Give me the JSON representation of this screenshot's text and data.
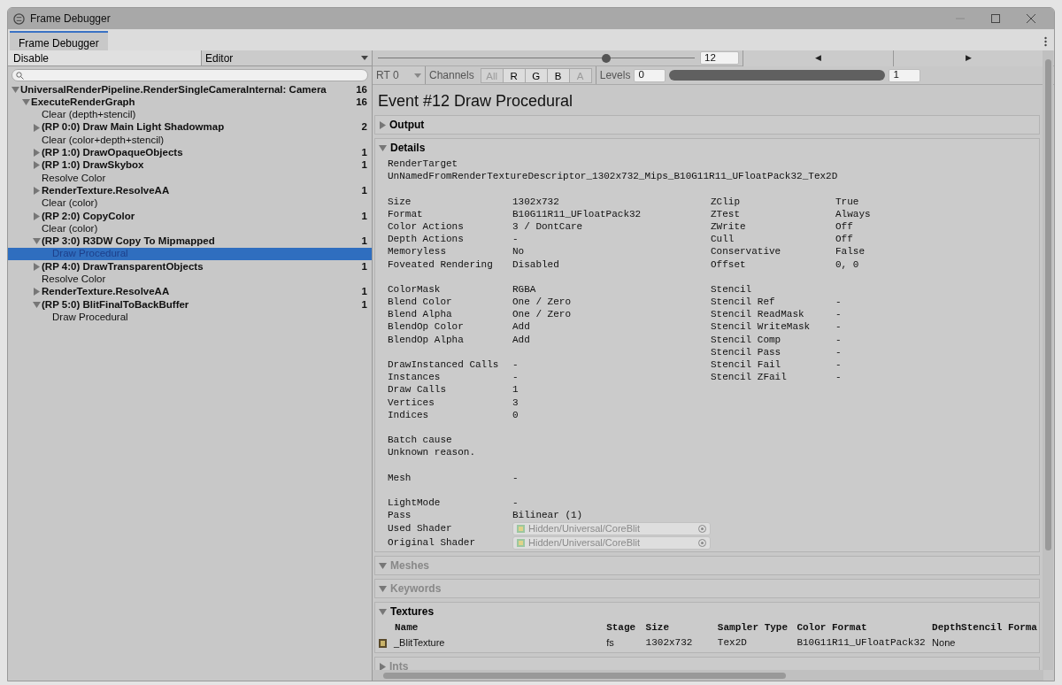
{
  "window": {
    "title": "Frame Debugger"
  },
  "tabs": [
    {
      "label": "Frame Debugger",
      "selected": true
    }
  ],
  "toolbar": {
    "toggle": "Disable",
    "target": "Editor"
  },
  "tree": [
    {
      "label": "UniversalRenderPipeline.RenderSingleCameraInternal: Camera",
      "count": "16",
      "expanded": true,
      "selected": false,
      "children": [
        {
          "label": "ExecuteRenderGraph",
          "count": "16",
          "expanded": true,
          "selected": false,
          "children": [
            {
              "label": "Clear (depth+stencil)",
              "selected": false
            },
            {
              "label": "(RP 0:0) Draw Main Light Shadowmap",
              "count": "2",
              "expanded": false,
              "selected": false
            },
            {
              "label": "Clear (color+depth+stencil)",
              "selected": false
            },
            {
              "label": "(RP 1:0) DrawOpaqueObjects",
              "count": "1",
              "expanded": false,
              "selected": false
            },
            {
              "label": "(RP 1:0) DrawSkybox",
              "count": "1",
              "expanded": false,
              "selected": false
            },
            {
              "label": "Resolve Color",
              "selected": false
            },
            {
              "label": "RenderTexture.ResolveAA",
              "count": "1",
              "expanded": false,
              "selected": false
            },
            {
              "label": "Clear (color)",
              "selected": false
            },
            {
              "label": "(RP 2:0) CopyColor",
              "count": "1",
              "expanded": false,
              "selected": false
            },
            {
              "label": "Clear (color)",
              "selected": false
            },
            {
              "label": "(RP 3:0) R3DW Copy To Mipmapped",
              "count": "1",
              "expanded": true,
              "selected": false,
              "children": [
                {
                  "label": "Draw Procedural",
                  "selected": true
                }
              ]
            },
            {
              "label": "(RP 4:0) DrawTransparentObjects",
              "count": "1",
              "expanded": false,
              "selected": false
            },
            {
              "label": "Resolve Color",
              "selected": false
            },
            {
              "label": "RenderTexture.ResolveAA",
              "count": "1",
              "expanded": false,
              "selected": false
            },
            {
              "label": "(RP 5:0) BlitFinalToBackBuffer",
              "count": "1",
              "expanded": true,
              "selected": false,
              "children": [
                {
                  "label": "Draw Procedural",
                  "selected": false
                }
              ]
            }
          ]
        }
      ]
    }
  ],
  "event_slider": {
    "level": 0.72,
    "value": "12",
    "prev": "◀",
    "next": "▶"
  },
  "view_bar": {
    "render_target": "RT 0",
    "channels_label": "Channels",
    "channels": [
      {
        "label": "All",
        "disabled": true
      },
      {
        "label": "R",
        "disabled": false
      },
      {
        "label": "G",
        "disabled": false
      },
      {
        "label": "B",
        "disabled": false
      },
      {
        "label": "A",
        "disabled": true
      }
    ],
    "levels_label": "Levels",
    "levels_min": "0",
    "levels": {
      "level": 1
    },
    "levels_max": "1"
  },
  "event_title": "Event #12 Draw Procedural",
  "sections": [
    {
      "title": "Output",
      "expanded": false,
      "disabled": false
    },
    {
      "title": "Details",
      "expanded": true,
      "disabled": false,
      "kind": "details"
    },
    {
      "title": "Meshes",
      "expanded": true,
      "disabled": true
    },
    {
      "title": "Keywords",
      "expanded": true,
      "disabled": true
    },
    {
      "title": "Textures",
      "expanded": true,
      "disabled": false,
      "kind": "textures"
    },
    {
      "title": "Ints",
      "expanded": false,
      "disabled": true
    }
  ],
  "details": {
    "render_target_label": "RenderTarget",
    "render_target": "UnNamedFromRenderTextureDescriptor_1302x732_Mips_B10G11R11_UFloatPack32_Tex2D",
    "left": [
      [
        {
          "kind": "pair",
          "label": "Size",
          "value": "1302x732"
        },
        {
          "kind": "pair",
          "label": "Format",
          "value": "B10G11R11_UFloatPack32"
        },
        {
          "kind": "pair",
          "label": "Color Actions",
          "value": "3 / DontCare"
        },
        {
          "kind": "pair",
          "label": "Depth Actions",
          "value": "-"
        },
        {
          "kind": "pair",
          "label": "Memoryless",
          "value": "No"
        },
        {
          "kind": "pair",
          "label": "Foveated Rendering",
          "value": "Disabled"
        }
      ],
      [
        {
          "kind": "pair",
          "label": "ColorMask",
          "value": "RGBA"
        },
        {
          "kind": "pair",
          "label": "Blend Color",
          "value": "One / Zero"
        },
        {
          "kind": "pair",
          "label": "Blend Alpha",
          "value": "One / Zero"
        },
        {
          "kind": "pair",
          "label": "BlendOp Color",
          "value": "Add"
        },
        {
          "kind": "pair",
          "label": "BlendOp Alpha",
          "value": "Add"
        }
      ],
      [
        {
          "kind": "pair",
          "label": "DrawInstanced Calls",
          "value": "-"
        },
        {
          "kind": "pair",
          "label": "Instances",
          "value": "-"
        },
        {
          "kind": "pair",
          "label": "Draw Calls",
          "value": "1"
        },
        {
          "kind": "pair",
          "label": "Vertices",
          "value": "3"
        },
        {
          "kind": "pair",
          "label": "Indices",
          "value": "0"
        }
      ],
      [
        {
          "kind": "line",
          "text": "Batch cause"
        },
        {
          "kind": "line",
          "text": "Unknown reason."
        }
      ],
      [
        {
          "kind": "pair",
          "label": "Mesh",
          "value": "-"
        }
      ],
      [
        {
          "kind": "pair",
          "label": "LightMode",
          "value": "-"
        },
        {
          "kind": "pair",
          "label": "Pass",
          "value": "Bilinear (1)"
        },
        {
          "kind": "object",
          "label": "Used Shader",
          "value": "Hidden/Universal/CoreBlit"
        },
        {
          "kind": "object",
          "label": "Original Shader",
          "value": "Hidden/Universal/CoreBlit"
        }
      ]
    ],
    "right": [
      [
        {
          "kind": "pair",
          "label": "ZClip",
          "value": "True"
        },
        {
          "kind": "pair",
          "label": "ZTest",
          "value": "Always"
        },
        {
          "kind": "pair",
          "label": "ZWrite",
          "value": "Off"
        },
        {
          "kind": "pair",
          "label": "Cull",
          "value": "Off"
        },
        {
          "kind": "pair",
          "label": "Conservative",
          "value": "False"
        },
        {
          "kind": "pair",
          "label": "Offset",
          "value": "0, 0"
        }
      ],
      [
        {
          "kind": "line",
          "text": "Stencil"
        },
        {
          "kind": "pair",
          "label": "Stencil Ref",
          "value": "-"
        },
        {
          "kind": "pair",
          "label": "Stencil ReadMask",
          "value": "-"
        },
        {
          "kind": "pair",
          "label": "Stencil WriteMask",
          "value": "-"
        },
        {
          "kind": "pair",
          "label": "Stencil Comp",
          "value": "-"
        },
        {
          "kind": "pair",
          "label": "Stencil Pass",
          "value": "-"
        },
        {
          "kind": "pair",
          "label": "Stencil Fail",
          "value": "-"
        },
        {
          "kind": "pair",
          "label": "Stencil ZFail",
          "value": "-"
        }
      ]
    ]
  },
  "textures": {
    "columns": [
      "Name",
      "Stage",
      "Size",
      "Sampler Type",
      "Color Format",
      "DepthStencil Forma"
    ],
    "rows": [
      [
        "_BlitTexture",
        "fs",
        "1302x732",
        "Tex2D",
        "B10G11R11_UFloatPack32",
        "None"
      ]
    ]
  }
}
